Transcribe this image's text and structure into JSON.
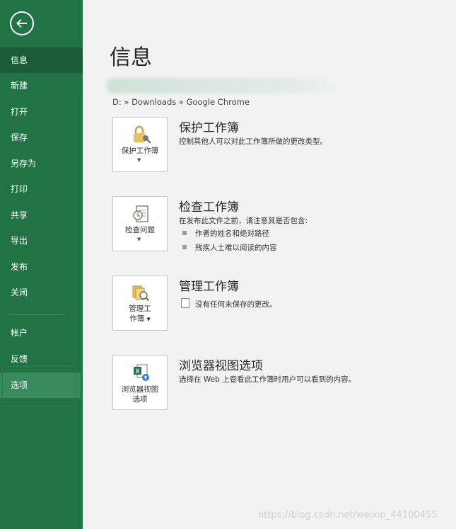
{
  "sidebar": {
    "items": [
      {
        "label": "信息"
      },
      {
        "label": "新建"
      },
      {
        "label": "打开"
      },
      {
        "label": "保存"
      },
      {
        "label": "另存为"
      },
      {
        "label": "打印"
      },
      {
        "label": "共享"
      },
      {
        "label": "导出"
      },
      {
        "label": "发布"
      },
      {
        "label": "关闭"
      },
      {
        "label": "帐户"
      },
      {
        "label": "反馈"
      },
      {
        "label": "选项"
      }
    ]
  },
  "main": {
    "title": "信息",
    "breadcrumb": "D: » Downloads » Google Chrome",
    "sections": [
      {
        "tile_label": "保护工作簿",
        "title": "保护工作簿",
        "description": "控制其他人可以对此工作簿所做的更改类型。"
      },
      {
        "tile_label": "检查问题",
        "title": "检查工作簿",
        "description": "在发布此文件之前，请注意其是否包含:",
        "bullets": [
          "作者的姓名和绝对路径",
          "残疾人士难以阅读的内容"
        ]
      },
      {
        "tile_label_line1": "管理工",
        "tile_label_line2": "作簿",
        "title": "管理工作簿",
        "description": "没有任何未保存的更改。"
      },
      {
        "tile_label_line1": "浏览器视图",
        "tile_label_line2": "选项",
        "title": "浏览器视图选项",
        "description": "选择在 Web 上查看此工作簿时用户可以看到的内容。"
      }
    ]
  },
  "watermark": "https://blog.csdn.net/weixin_44100455",
  "colors": {
    "sidebar": "#217346",
    "sidebar_active": "#1a5c38",
    "highlight_box": "#e0262b"
  }
}
